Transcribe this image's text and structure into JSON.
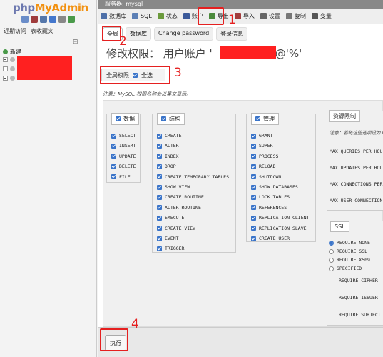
{
  "sidebar": {
    "logo_php": "php",
    "logo_my": "MyAdmin",
    "tabs": [
      "近期访问",
      "表收藏夹"
    ],
    "tree_collapse": "⊟",
    "new_label": "新建"
  },
  "topbar": {
    "server_label": "服务器: mysql"
  },
  "toptabs": [
    {
      "label": "数据库",
      "icon": "database-icon",
      "color": "#4d6fa8"
    },
    {
      "label": "SQL",
      "icon": "sql-icon",
      "color": "#5b7fb5"
    },
    {
      "label": "状态",
      "icon": "status-icon",
      "color": "#6b9a3c"
    },
    {
      "label": "账户",
      "icon": "users-icon",
      "color": "#3c5a9a"
    },
    {
      "label": "导出",
      "icon": "export-icon",
      "color": "#4b8a3c"
    },
    {
      "label": "导入",
      "icon": "import-icon",
      "color": "#a23c3c"
    },
    {
      "label": "设置",
      "icon": "settings-icon",
      "color": "#666666"
    },
    {
      "label": "复制",
      "icon": "replication-icon",
      "color": "#777777"
    },
    {
      "label": "变量",
      "icon": "variables-icon",
      "color": "#555555"
    }
  ],
  "subtabs": [
    "全局",
    "数据库",
    "Change password",
    "登录信息"
  ],
  "title": {
    "prefix": "修改权限：  用户账户 '",
    "suffix": "'@'%'"
  },
  "global": {
    "label": "全局权限",
    "check_all": "全选"
  },
  "note": "注意：MySQL 权限名称会以英文显示。",
  "groups": {
    "data": {
      "label": "数据",
      "items": [
        "SELECT",
        "INSERT",
        "UPDATE",
        "DELETE",
        "FILE"
      ]
    },
    "structure": {
      "label": "结构",
      "items": [
        "CREATE",
        "ALTER",
        "INDEX",
        "DROP",
        "CREATE TEMPORARY TABLES",
        "SHOW VIEW",
        "CREATE ROUTINE",
        "ALTER ROUTINE",
        "EXECUTE",
        "CREATE VIEW",
        "EVENT",
        "TRIGGER"
      ]
    },
    "admin": {
      "label": "管理",
      "items": [
        "GRANT",
        "SUPER",
        "PROCESS",
        "RELOAD",
        "SHUTDOWN",
        "SHOW DATABASES",
        "LOCK TABLES",
        "REFERENCES",
        "REPLICATION CLIENT",
        "REPLICATION SLAVE",
        "CREATE USER"
      ]
    }
  },
  "resource": {
    "label": "资源限制",
    "note": "注意：若将这些选项设为 0",
    "lines": [
      "MAX QUERIES PER HOU",
      "MAX UPDATES PER HOU",
      "MAX CONNECTIONS PER",
      "MAX USER_CONNECTION"
    ]
  },
  "ssl": {
    "label": "SSL",
    "options": [
      "REQUIRE NONE",
      "REQUIRE SSL",
      "REQUIRE X509",
      "SPECIFIED"
    ],
    "selected": "REQUIRE NONE",
    "fields": [
      "REQUIRE CIPHER",
      "REQUIRE ISSUER",
      "REQUIRE SUBJECT"
    ]
  },
  "footer": {
    "go_label": "执行"
  },
  "annotations": [
    "1",
    "2",
    "3",
    "4"
  ],
  "colors": {
    "annotation": "#e52020",
    "redaction": "#ff2020",
    "checkbox": "#3a74c9"
  }
}
